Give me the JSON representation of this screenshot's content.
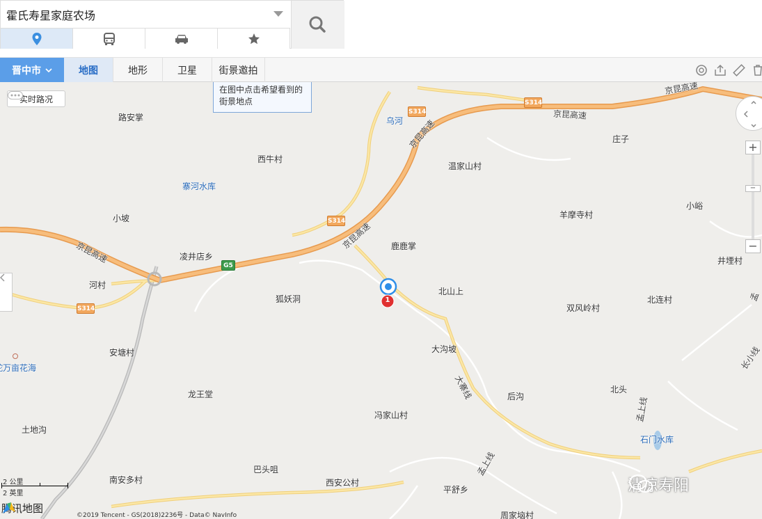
{
  "search": {
    "value": "霍氏寿星家庭农场"
  },
  "mode_tabs": [
    {
      "name": "location-pin-icon"
    },
    {
      "name": "bus-icon"
    },
    {
      "name": "car-icon"
    },
    {
      "name": "star-icon"
    }
  ],
  "toolbar": {
    "city": "晋中市",
    "map_types": [
      "地图",
      "地形",
      "卫星",
      "街景邀拍"
    ],
    "active_type": "地图"
  },
  "tooltip": {
    "line1": "在图中点击希望看到的",
    "line2": "街景地点"
  },
  "traffic_button": "实时路况",
  "places": [
    {
      "label": "路安掌"
    },
    {
      "label": "乌河",
      "blue": true
    },
    {
      "label": "西牛村"
    },
    {
      "label": "寨河水库",
      "blue": true
    },
    {
      "label": "温家山村"
    },
    {
      "label": "庄子"
    },
    {
      "label": "小坡"
    },
    {
      "label": "羊摩寺村"
    },
    {
      "label": "小峪"
    },
    {
      "label": "凌井店乡"
    },
    {
      "label": "鹿鹿掌"
    },
    {
      "label": "井堙村"
    },
    {
      "label": "河村"
    },
    {
      "label": "狐妖洞"
    },
    {
      "label": "北山上"
    },
    {
      "label": "双风岭村"
    },
    {
      "label": "北连村"
    },
    {
      "label": "安塘村"
    },
    {
      "label": "大沟坡"
    },
    {
      "label": "蛇万亩花海",
      "blue": true
    },
    {
      "label": "龙王堂"
    },
    {
      "label": "后沟"
    },
    {
      "label": "北头"
    },
    {
      "label": "冯家山村"
    },
    {
      "label": "土地沟"
    },
    {
      "label": "石门水库",
      "blue": true
    },
    {
      "label": "巴头咀"
    },
    {
      "label": "南安多村"
    },
    {
      "label": "西安公村"
    },
    {
      "label": "平舒乡"
    },
    {
      "label": "周家垴村"
    }
  ],
  "roads": [
    "京昆高速",
    "京昆高速",
    "京昆高速",
    "京昆高速",
    "大寨线",
    "孟上线",
    "孟上线",
    "长小线",
    "孟"
  ],
  "shields": [
    "S314",
    "S314",
    "S314",
    "S314",
    "G5"
  ],
  "marker_number": "1",
  "scale": {
    "km": "2 公里",
    "mi": "2 英里"
  },
  "footer": {
    "logo": "腾讯地图",
    "copyright": "©2019 Tencent - GS(2018)2236号 - Data© NavInfo"
  },
  "watermark": "清凉寿阳",
  "colors": {
    "highway": "#f5b06a",
    "road": "#fde7a8",
    "accent": "#5b9ee8",
    "marker": "#e03030"
  }
}
